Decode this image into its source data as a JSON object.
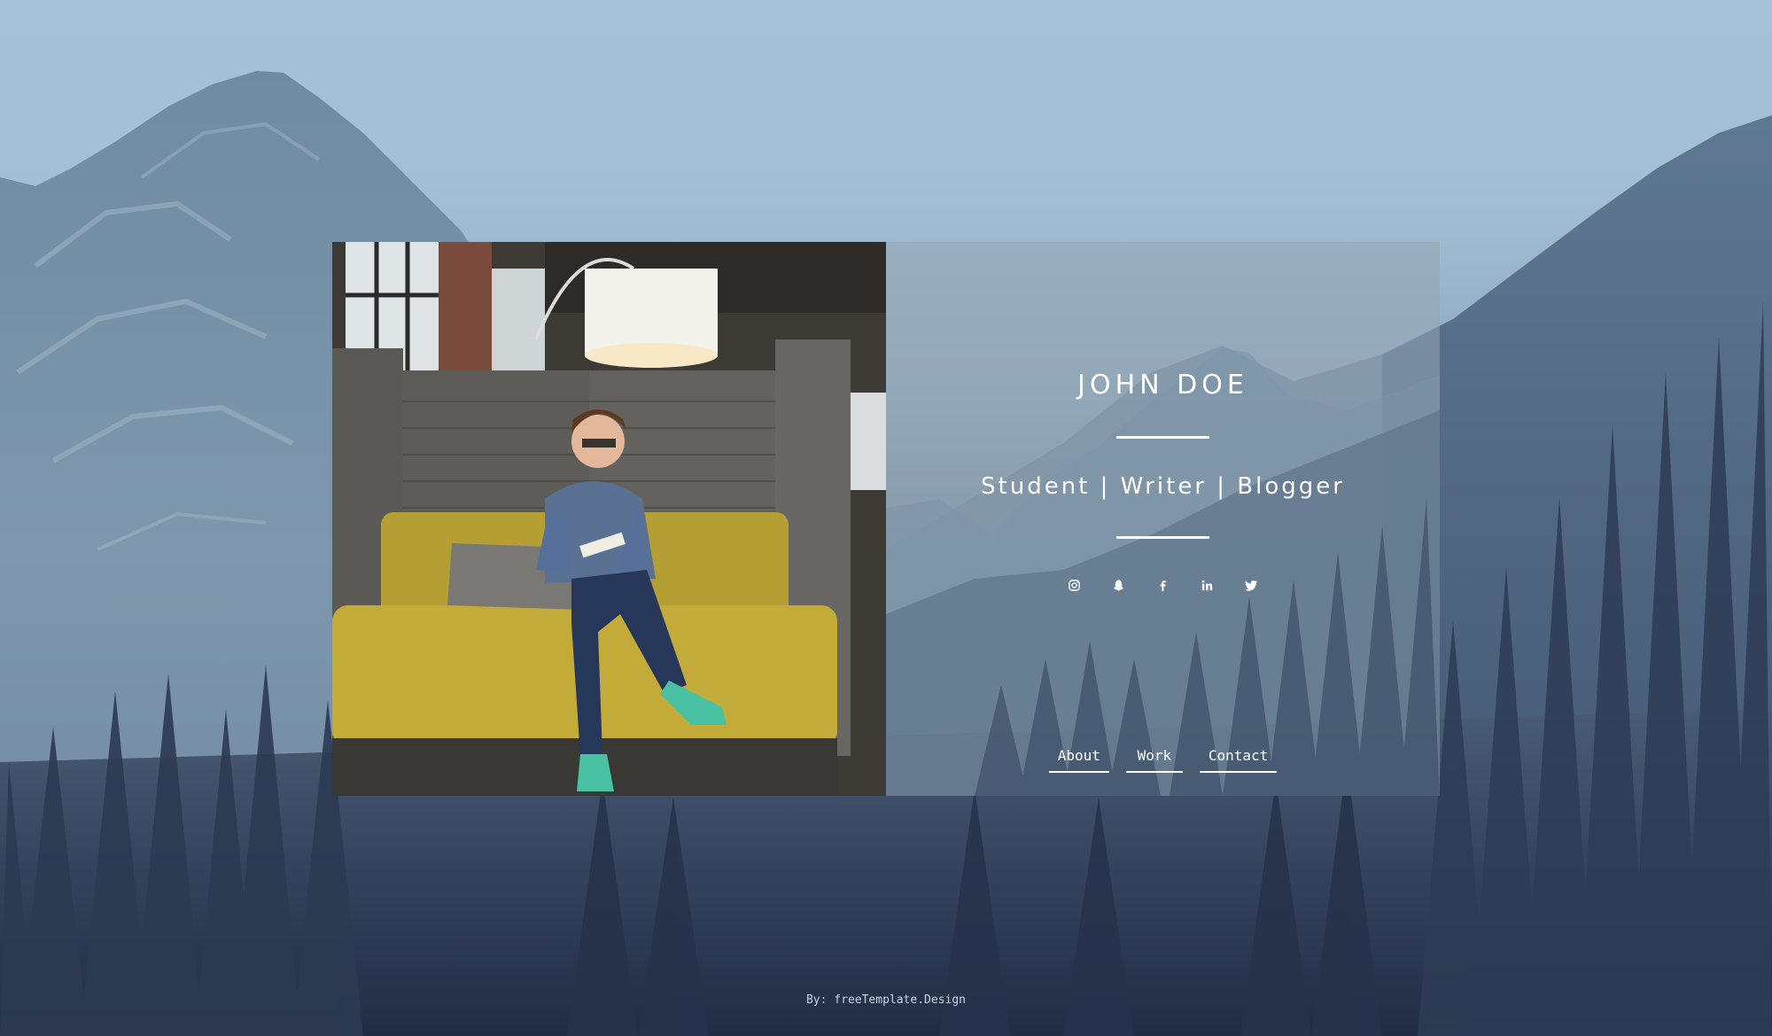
{
  "profile": {
    "name": "JOHN DOE",
    "tagline": "Student | Writer | Blogger"
  },
  "social": [
    {
      "icon": "instagram-icon",
      "label": "Instagram"
    },
    {
      "icon": "snapchat-icon",
      "label": "Snapchat"
    },
    {
      "icon": "facebook-icon",
      "label": "Facebook"
    },
    {
      "icon": "linkedin-icon",
      "label": "LinkedIn"
    },
    {
      "icon": "twitter-icon",
      "label": "Twitter"
    }
  ],
  "nav": {
    "about": "About",
    "work": "Work",
    "contact": "Contact"
  },
  "footer": {
    "credit": "By: freeTemplate.Design"
  },
  "colors": {
    "sky": "#a6c2d6",
    "forest": "#26314b",
    "text": "#ffffff",
    "card_overlay": "#96a5b2"
  }
}
